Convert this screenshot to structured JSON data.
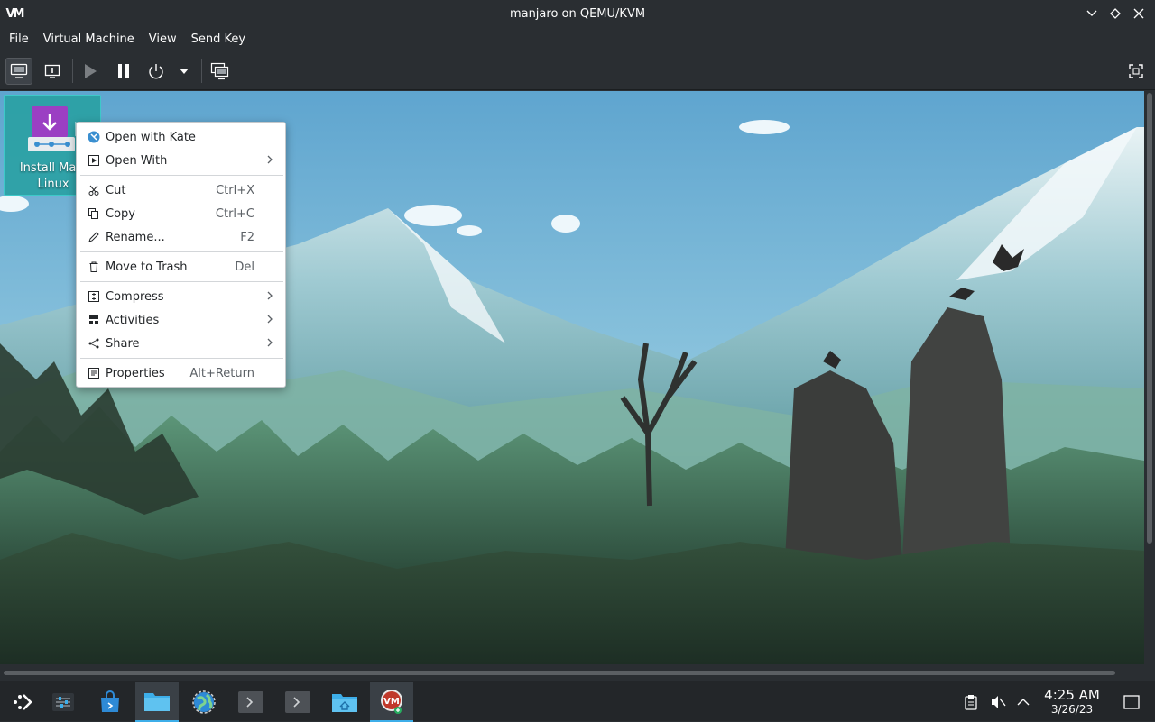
{
  "window": {
    "title": "manjaro on QEMU/KVM",
    "app_logo": "VM"
  },
  "menubar": {
    "items": [
      "File",
      "Virtual Machine",
      "View",
      "Send Key"
    ]
  },
  "toolbar": {
    "buttons": [
      {
        "icon": "console-icon",
        "active": true
      },
      {
        "icon": "details-icon"
      },
      {
        "icon": "play-icon"
      },
      {
        "icon": "pause-icon"
      },
      {
        "icon": "power-icon"
      },
      {
        "icon": "dropdown-arrow-icon"
      },
      {
        "icon": "snapshots-icon"
      },
      {
        "icon": "fullscreen-icon"
      }
    ]
  },
  "desktop": {
    "icon_label": "Install Manjaro Linux",
    "icon_label_line1": "Install Manj",
    "icon_label_line2": "Linux"
  },
  "context_menu": {
    "items": [
      {
        "label": "Open with Kate",
        "icon": "kate-icon",
        "shortcut": "",
        "submenu": false
      },
      {
        "label": "Open With",
        "icon": "open-with-icon",
        "shortcut": "",
        "submenu": true
      },
      {
        "label": "Cut",
        "icon": "scissors-icon",
        "shortcut": "Ctrl+X",
        "submenu": false
      },
      {
        "label": "Copy",
        "icon": "copy-icon",
        "shortcut": "Ctrl+C",
        "submenu": false
      },
      {
        "label": "Rename...",
        "icon": "pencil-icon",
        "shortcut": "F2",
        "submenu": false
      },
      {
        "label": "Move to Trash",
        "icon": "trash-icon",
        "shortcut": "Del",
        "submenu": false
      },
      {
        "label": "Compress",
        "icon": "compress-icon",
        "shortcut": "",
        "submenu": true
      },
      {
        "label": "Activities",
        "icon": "activities-icon",
        "shortcut": "",
        "submenu": true
      },
      {
        "label": "Share",
        "icon": "share-icon",
        "shortcut": "",
        "submenu": true
      },
      {
        "label": "Properties",
        "icon": "properties-icon",
        "shortcut": "Alt+Return",
        "submenu": false
      }
    ]
  },
  "taskbar": {
    "apps": [
      {
        "name": "application-launcher",
        "icon": "launcher-icon"
      },
      {
        "name": "system-settings-tweaks",
        "icon": "sliders-icon"
      },
      {
        "name": "discover",
        "icon": "store-bag-icon"
      },
      {
        "name": "dolphin",
        "icon": "folder-icon",
        "active": true
      },
      {
        "name": "browser",
        "icon": "globe-icon"
      },
      {
        "name": "terminal-1",
        "icon": "terminal-icon"
      },
      {
        "name": "terminal-2",
        "icon": "terminal-icon"
      },
      {
        "name": "home-folder",
        "icon": "home-folder-icon"
      },
      {
        "name": "virt-manager",
        "icon": "vm-icon",
        "active": true
      }
    ],
    "tray": [
      "clipboard-icon",
      "volume-muted-icon",
      "expand-tray-icon"
    ],
    "clock_time": "4:25 AM",
    "clock_date": "3/26/23",
    "show_desktop_icon": "show-desktop-icon"
  },
  "colors": {
    "chrome": "#2a2e32",
    "taskbar": "#232629",
    "accent": "#3daee9",
    "desktop_icon_bg": "#26a0a0",
    "manjaro_purple": "#9b3fc3"
  }
}
